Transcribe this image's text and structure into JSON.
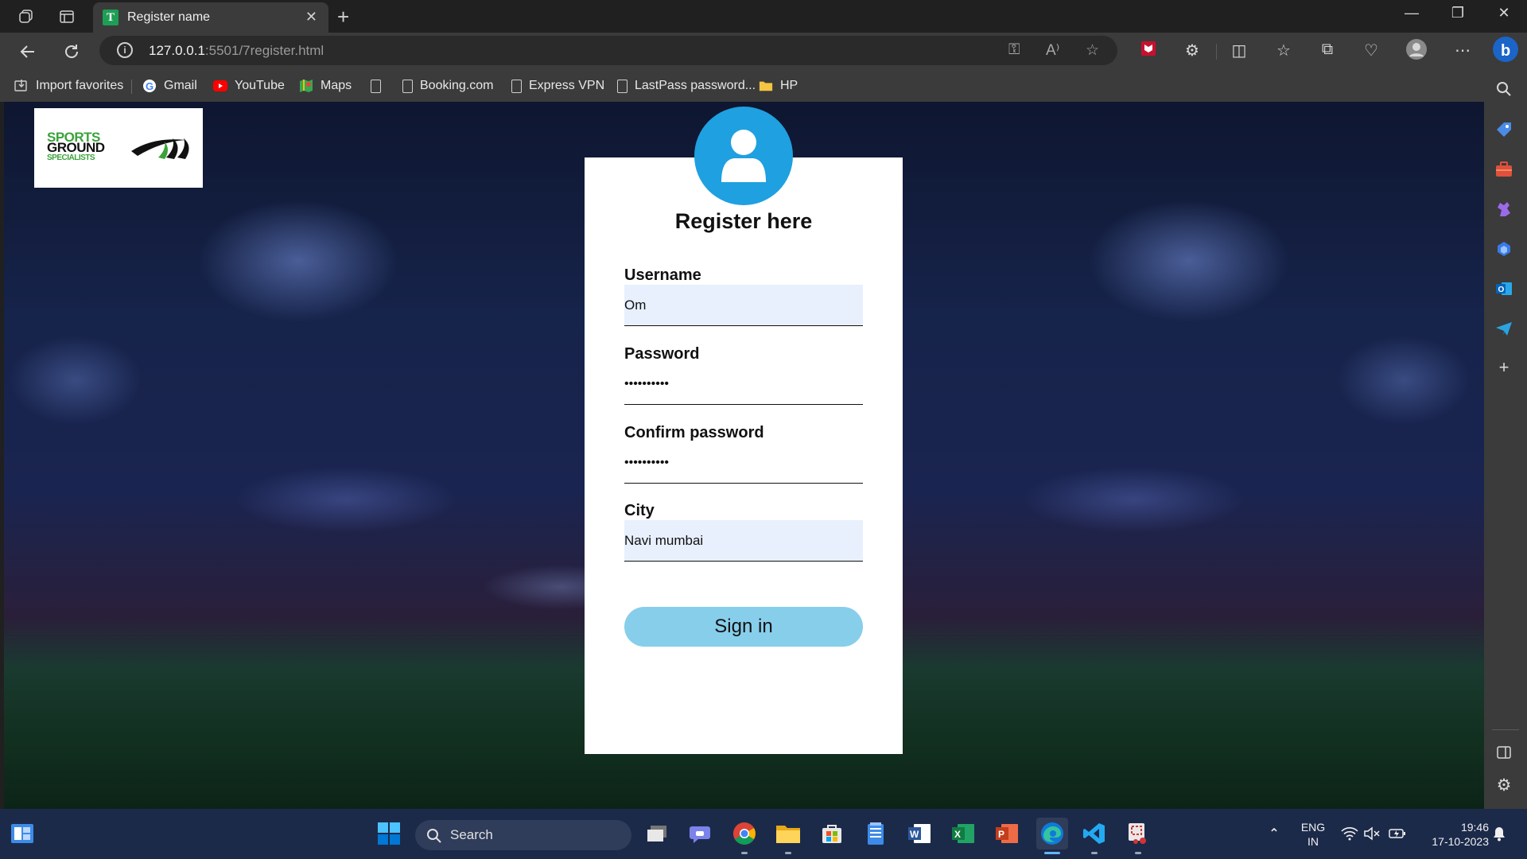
{
  "browser": {
    "tab_title": "Register name",
    "tab_favicon_letter": "T",
    "url_host": "127.0.0.1",
    "url_path": ":5501/7register.html",
    "read_aloud_label": "A⁾"
  },
  "bookmarks": [
    {
      "label": "Import favorites"
    },
    {
      "label": "Gmail"
    },
    {
      "label": "YouTube"
    },
    {
      "label": "Maps"
    },
    {
      "label": "Booking.com"
    },
    {
      "label": "Express VPN"
    },
    {
      "label": "LastPass password..."
    },
    {
      "label": "HP"
    }
  ],
  "logo": {
    "line1": "SPORTS",
    "line2": "GROUND",
    "line3": "SPECIALISTS"
  },
  "form": {
    "title": "Register here",
    "username_label": "Username",
    "username_value": "Om",
    "password_label": "Password",
    "password_value": "••••••••••",
    "confirm_label": "Confirm password",
    "confirm_value": "••••••••••",
    "city_label": "City",
    "city_value": "Navi mumbai",
    "submit_label": "Sign in"
  },
  "taskbar": {
    "search_label": "Search",
    "lang_line1": "ENG",
    "lang_line2": "IN",
    "time": "19:46",
    "date": "17-10-2023"
  },
  "colors": {
    "avatar": "#1fa0e0",
    "signin_button": "#87ceeb",
    "autofill_bg": "#e8f0fe"
  }
}
